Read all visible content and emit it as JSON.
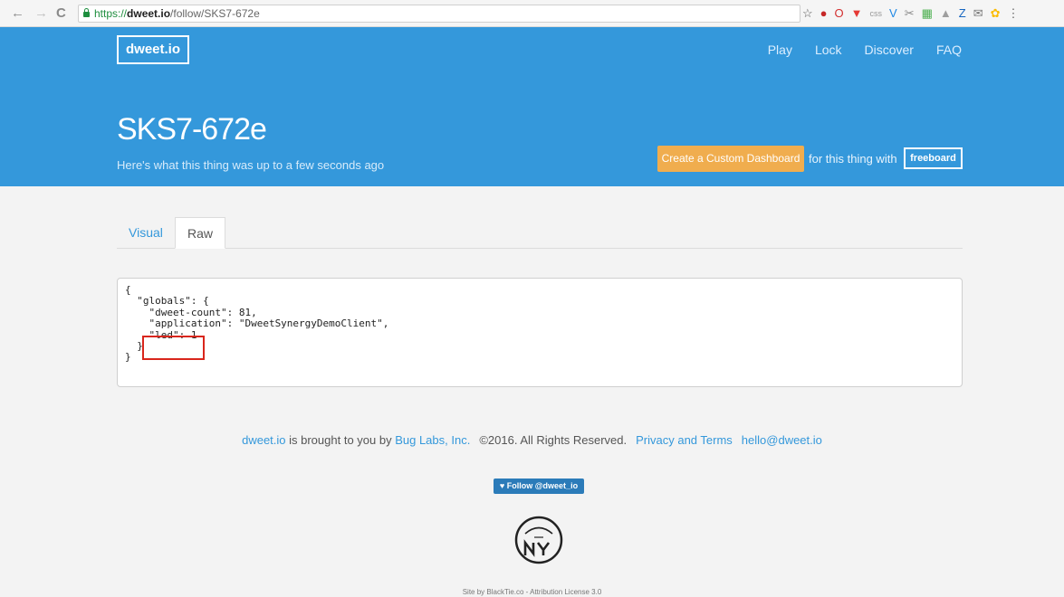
{
  "browser": {
    "nav": {
      "back": "←",
      "forward": "→",
      "reload": "C"
    },
    "url": {
      "scheme": "https://",
      "host": "dweet.io",
      "path": "/follow/SKS7-672e"
    },
    "extensions": [
      {
        "glyph": "☆",
        "color": "#555555"
      },
      {
        "glyph": "●",
        "color": "#c62828"
      },
      {
        "glyph": "O",
        "color": "#d32f2f"
      },
      {
        "glyph": "▼",
        "color": "#e53935"
      },
      {
        "glyph": "css",
        "color": "#999999"
      },
      {
        "glyph": "V",
        "color": "#1e88e5"
      },
      {
        "glyph": "✂",
        "color": "#888888"
      },
      {
        "glyph": "▦",
        "color": "#4caf50"
      },
      {
        "glyph": "▲",
        "color": "#9e9e9e"
      },
      {
        "glyph": "Z",
        "color": "#1565c0"
      },
      {
        "glyph": "✉",
        "color": "#777777"
      },
      {
        "glyph": "✿",
        "color": "#fbbc05"
      },
      {
        "glyph": "⋮",
        "color": "#666666"
      }
    ]
  },
  "header": {
    "logo": "dweet.io",
    "nav": [
      "Play",
      "Lock",
      "Discover",
      "FAQ"
    ],
    "thing_name": "SKS7-672e",
    "subtitle": "Here's what this thing was up to a few seconds ago",
    "cta_label": "Create a Custom Dashboard",
    "cta_tail": "for this thing with",
    "freeboard_label": "freeboard"
  },
  "tabs": {
    "visual": "Visual",
    "raw": "Raw"
  },
  "raw_json": "{\n  \"globals\": {\n    \"dweet-count\": 81,\n    \"application\": \"DweetSynergyDemoClient\",\n    \"led\": 1\n  }\n}",
  "footer": {
    "brand_link": "dweet.io",
    "brought_by": " is brought to you by ",
    "company_link": "Bug Labs, Inc.",
    "copyright": "©2016. All Rights Reserved.",
    "privacy_link": "Privacy and Terms",
    "email_link": "hello@dweet.io",
    "twitter_label": "Follow @dweet_io",
    "credit": "Site by BlackTie.co - Attribution License 3.0"
  },
  "colors": {
    "header_blue": "#3498db",
    "accent_orange": "#f0ad4e",
    "highlight_red": "#d9261c"
  }
}
